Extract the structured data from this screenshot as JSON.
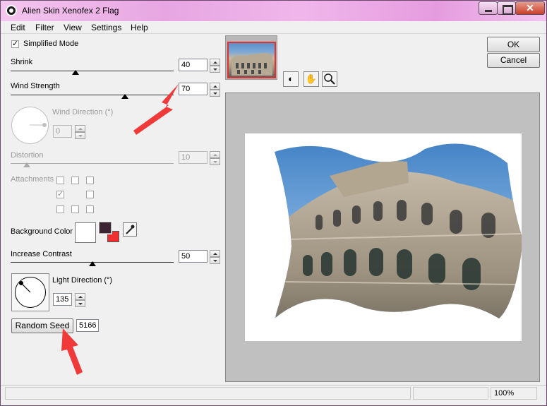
{
  "window": {
    "title": "Alien Skin Xenofex 2 Flag"
  },
  "menu": [
    "Edit",
    "Filter",
    "View",
    "Settings",
    "Help"
  ],
  "controls": {
    "simplified_mode": {
      "label": "Simplified Mode",
      "checked": true
    },
    "shrink": {
      "label": "Shrink",
      "value": "40",
      "level": 0.4
    },
    "wind_strength": {
      "label": "Wind Strength",
      "value": "70",
      "level": 0.7
    },
    "wind_direction": {
      "label": "Wind Direction (°)",
      "value": "0"
    },
    "distortion": {
      "label": "Distortion",
      "value": "10",
      "level": 0.1
    },
    "attachments": {
      "label": "Attachments"
    },
    "background_color": {
      "label": "Background Color",
      "color": "#ffffff"
    },
    "front_color": "#3d2433",
    "back_color": "#ee3030",
    "increase_contrast": {
      "label": "Increase Contrast",
      "value": "50",
      "level": 0.5
    },
    "light_direction": {
      "label": "Light Direction (°)",
      "value": "135"
    },
    "random_seed": {
      "label": "Random Seed",
      "value": "5166"
    }
  },
  "buttons": {
    "ok": "OK",
    "cancel": "Cancel"
  },
  "status": {
    "zoom": "100%"
  },
  "colors": {
    "accent_red": "#f03a3a",
    "title_pink": "#e9a8e3"
  }
}
